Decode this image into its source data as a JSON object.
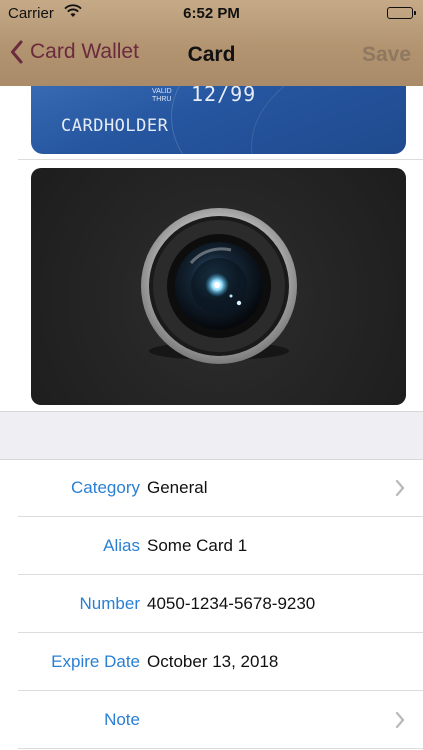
{
  "status_bar": {
    "carrier": "Carrier",
    "time": "6:52 PM"
  },
  "nav": {
    "back_label": "Card Wallet",
    "title": "Card",
    "save_label": "Save"
  },
  "card_preview": {
    "valid_line1": "VALID",
    "valid_line2": "THRU",
    "expiry": "12/99",
    "holder": "CARDHOLDER"
  },
  "photo": {
    "icon": "camera-lens-icon"
  },
  "fields": [
    {
      "label": "Category",
      "value": "General",
      "has_chevron": true
    },
    {
      "label": "Alias",
      "value": "Some Card 1",
      "has_chevron": false
    },
    {
      "label": "Number",
      "value": "4050-1234-5678-9230",
      "has_chevron": false
    },
    {
      "label": "Expire Date",
      "value": "October 13, 2018",
      "has_chevron": false
    },
    {
      "label": "Note",
      "value": "",
      "has_chevron": true
    }
  ],
  "colors": {
    "nav_gradient": "#b29471",
    "back_tint": "#6b2a3e",
    "label_blue": "#2a7fd3",
    "card_blue": "#2656a0"
  }
}
